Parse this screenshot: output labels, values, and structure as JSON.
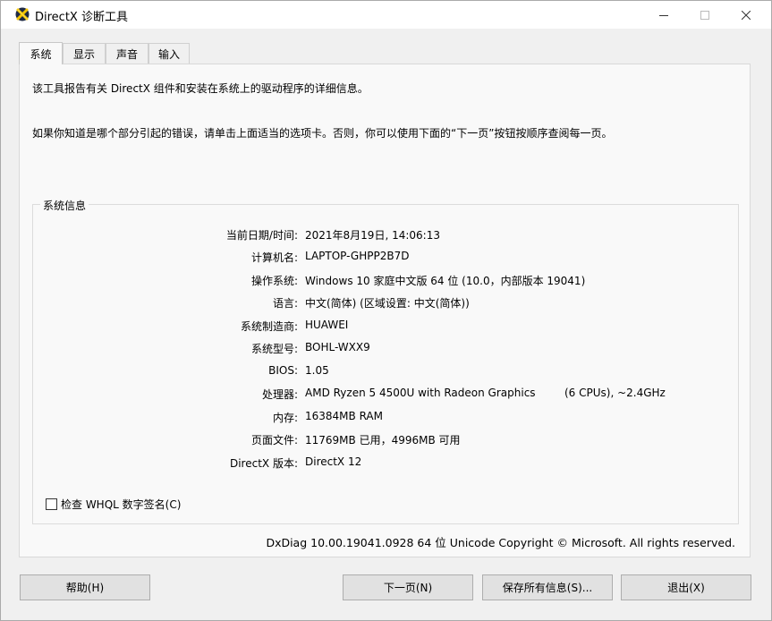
{
  "window": {
    "title": "DirectX 诊断工具"
  },
  "tabs": [
    {
      "label": "系统"
    },
    {
      "label": "显示"
    },
    {
      "label": "声音"
    },
    {
      "label": "输入"
    }
  ],
  "intro": {
    "line1": "该工具报告有关 DirectX 组件和安装在系统上的驱动程序的详细信息。",
    "line2": "如果你知道是哪个部分引起的错误，请单击上面适当的选项卡。否则，你可以使用下面的“下一页”按钮按顺序查阅每一页。"
  },
  "system_info": {
    "title": "系统信息",
    "rows": [
      {
        "label": "当前日期/时间:",
        "value": "2021年8月19日, 14:06:13"
      },
      {
        "label": "计算机名:",
        "value": "LAPTOP-GHPP2B7D"
      },
      {
        "label": "操作系统:",
        "value": "Windows 10 家庭中文版 64 位 (10.0，内部版本 19041)"
      },
      {
        "label": "语言:",
        "value": "中文(简体) (区域设置: 中文(简体))"
      },
      {
        "label": "系统制造商:",
        "value": "HUAWEI"
      },
      {
        "label": "系统型号:",
        "value": "BOHL-WXX9"
      },
      {
        "label": "BIOS:",
        "value": "1.05"
      },
      {
        "label": "处理器:",
        "value": "AMD Ryzen 5 4500U with Radeon Graphics"
      },
      {
        "label": "内存:",
        "value": "16384MB RAM"
      },
      {
        "label": "页面文件:",
        "value": "11769MB 已用，4996MB 可用"
      },
      {
        "label": "DirectX 版本:",
        "value": "DirectX 12"
      }
    ],
    "processor_extra": "(6 CPUs), ~2.4GHz"
  },
  "whql": {
    "label": "检查 WHQL 数字签名(C)",
    "checked": false
  },
  "copyright": "DxDiag 10.00.19041.0928 64 位 Unicode  Copyright © Microsoft. All rights reserved.",
  "buttons": {
    "help": "帮助(H)",
    "next": "下一页(N)",
    "save": "保存所有信息(S)...",
    "exit": "退出(X)"
  },
  "icons": {
    "app": "directx-icon",
    "minimize": "minimize-icon",
    "maximize": "maximize-icon",
    "close": "close-icon"
  },
  "colors": {
    "background": "#f0f0f0",
    "panel": "#f9f9f9",
    "button": "#e1e1e1"
  }
}
